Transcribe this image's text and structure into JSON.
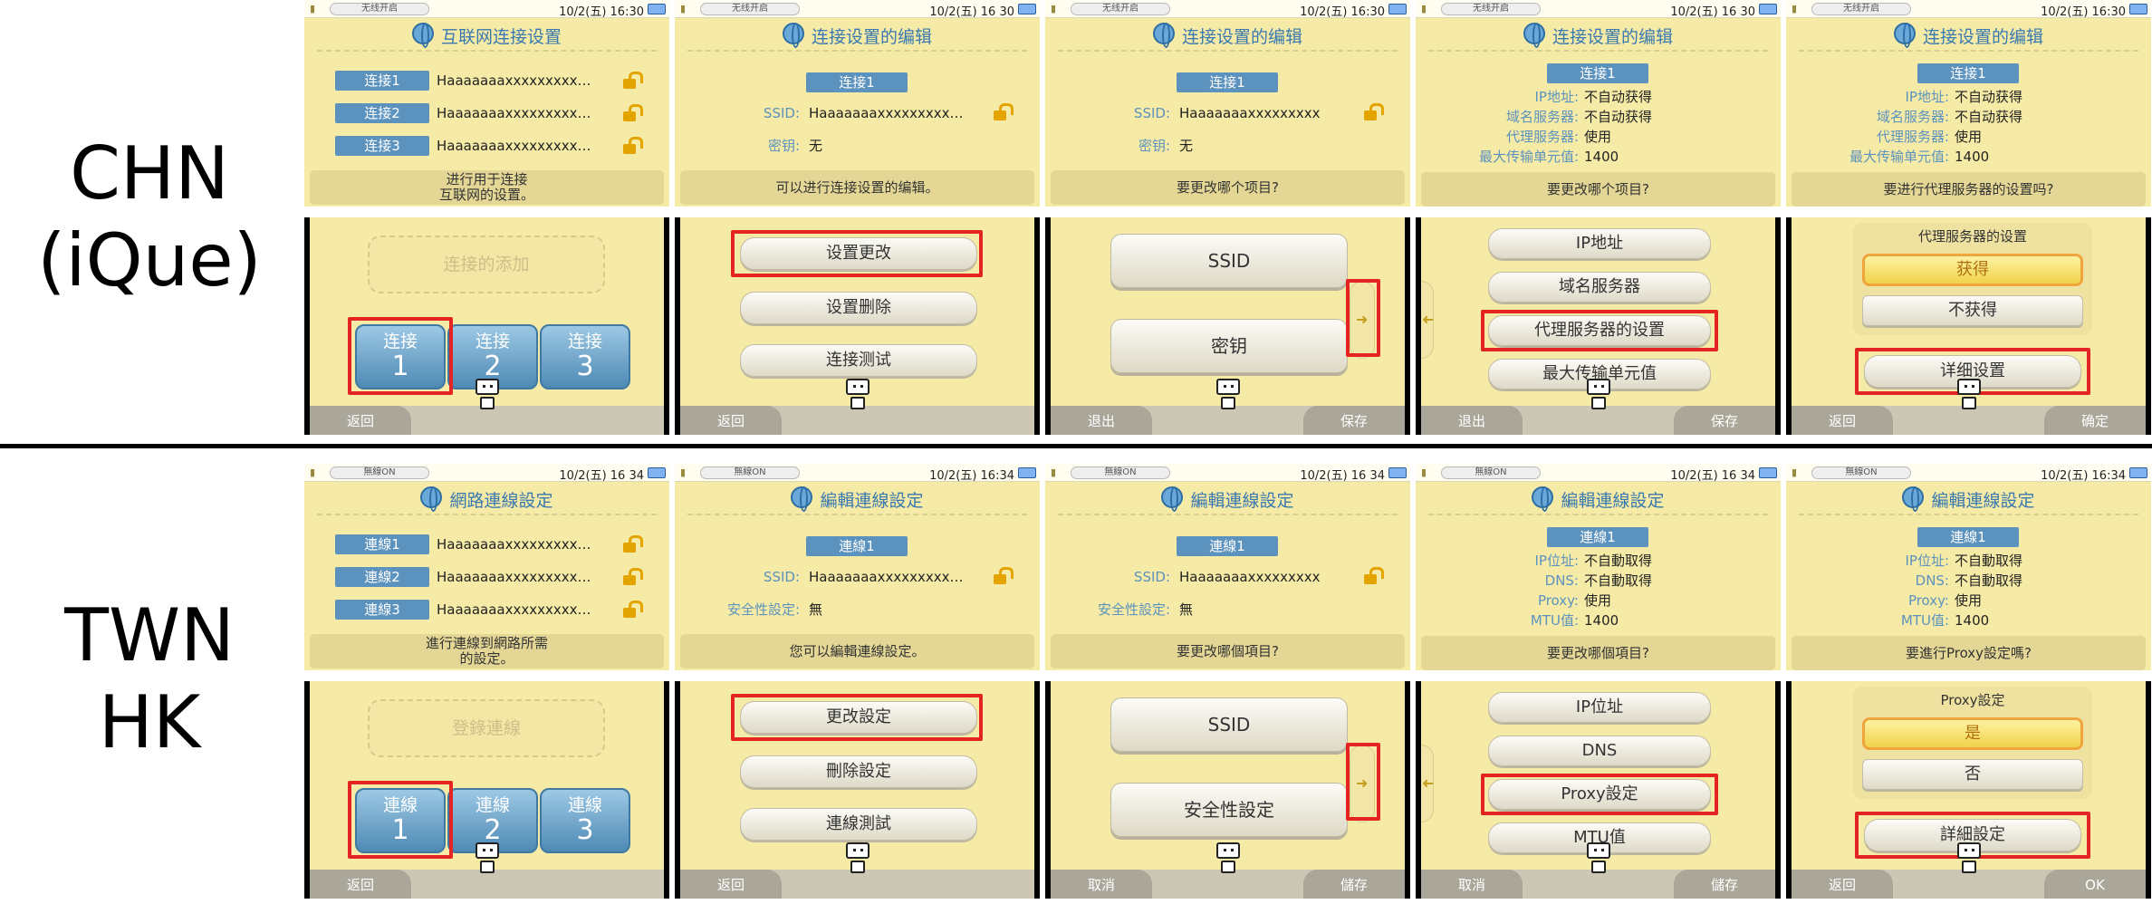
{
  "regions": [
    {
      "lines": [
        "CHN",
        "(iQue)"
      ]
    },
    {
      "lines": [
        "TWN",
        "HK"
      ]
    }
  ],
  "rows": [
    {
      "screens": [
        {
          "wlan": "无线开启",
          "time": "10/2(五) 16:30",
          "title": "互联网连接设置",
          "connections": [
            {
              "tag": "连接1",
              "ssid": "Haaaaaaaxxxxxxxxx…"
            },
            {
              "tag": "连接2",
              "ssid": "Haaaaaaaxxxxxxxxx…"
            },
            {
              "tag": "连接3",
              "ssid": "Haaaaaaaxxxxxxxxx…"
            }
          ],
          "message": "进行用于连接\n互联网的设置。",
          "add_label": "连接的添加",
          "conn_btn_top": "连接",
          "conn_nums": [
            "1",
            "2",
            "3"
          ],
          "left": "返回",
          "right": ""
        },
        {
          "wlan": "无线开启",
          "time": "10/2(五) 16 30",
          "title": "连接设置的编辑",
          "tag": "连接1",
          "fields": [
            {
              "label": "SSID:",
              "value": "Haaaaaaaxxxxxxxxx…"
            },
            {
              "label": "密钥:",
              "value": "无"
            }
          ],
          "message": "可以进行连接设置的编辑。",
          "menu": [
            "设置更改",
            "设置删除",
            "连接测试"
          ],
          "left": "返回",
          "right": ""
        },
        {
          "wlan": "无线开启",
          "time": "10/2(五) 16:30",
          "title": "连接设置的编辑",
          "tag": "连接1",
          "fields": [
            {
              "label": "SSID:",
              "value": "Haaaaaaaxxxxxxxxx"
            },
            {
              "label": "密钥:",
              "value": "无"
            }
          ],
          "message": "要更改哪个项目?",
          "big": [
            "SSID",
            "密钥"
          ],
          "arrow": "➜",
          "left": "退出",
          "right": "保存"
        },
        {
          "wlan": "无线开启",
          "time": "10/2(五) 16 30",
          "title": "连接设置的编辑",
          "tag": "连接1",
          "info": [
            {
              "label": "IP地址:",
              "value": "不自动获得"
            },
            {
              "label": "域名服务器:",
              "value": "不自动获得"
            },
            {
              "label": "代理服务器:",
              "value": "使用"
            },
            {
              "label": "最大传输单元值:",
              "value": "1400"
            }
          ],
          "message": "要更改哪个项目?",
          "menu": [
            "IP地址",
            "域名服务器",
            "代理服务器的设置",
            "最大传输单元值"
          ],
          "arrow": "➜",
          "left": "退出",
          "right": "保存"
        },
        {
          "wlan": "无线开启",
          "time": "10/2(五) 16:30",
          "title": "连接设置的编辑",
          "tag": "连接1",
          "info": [
            {
              "label": "IP地址:",
              "value": "不自动获得"
            },
            {
              "label": "域名服务器:",
              "value": "不自动获得"
            },
            {
              "label": "代理服务器:",
              "value": "使用"
            },
            {
              "label": "最大传输单元值:",
              "value": "1400"
            }
          ],
          "message": "要进行代理服务器的设置吗?",
          "panel_title": "代理服务器的设置",
          "opt_yes": "获得",
          "opt_no": "不获得",
          "detail": "详细设置",
          "left": "返回",
          "right": "确定"
        }
      ]
    },
    {
      "screens": [
        {
          "wlan": "無線ON",
          "time": "10/2(五) 16 34",
          "title": "網路連線設定",
          "connections": [
            {
              "tag": "連線1",
              "ssid": "Haaaaaaaxxxxxxxxx…"
            },
            {
              "tag": "連線2",
              "ssid": "Haaaaaaaxxxxxxxxx…"
            },
            {
              "tag": "連線3",
              "ssid": "Haaaaaaaxxxxxxxxx…"
            }
          ],
          "message": "進行連線到網路所需\n的設定。",
          "add_label": "登錄連線",
          "conn_btn_top": "連線",
          "conn_nums": [
            "1",
            "2",
            "3"
          ],
          "left": "返回",
          "right": ""
        },
        {
          "wlan": "無線ON",
          "time": "10/2(五) 16:34",
          "title": "編輯連線設定",
          "tag": "連線1",
          "fields": [
            {
              "label": "SSID:",
              "value": "Haaaaaaaxxxxxxxxx…"
            },
            {
              "label": "安全性設定:",
              "value": "無"
            }
          ],
          "message": "您可以編輯連線設定。",
          "menu": [
            "更改設定",
            "刪除設定",
            "連線測試"
          ],
          "left": "返回",
          "right": ""
        },
        {
          "wlan": "無線ON",
          "time": "10/2(五) 16 34",
          "title": "編輯連線設定",
          "tag": "連線1",
          "fields": [
            {
              "label": "SSID:",
              "value": "Haaaaaaaxxxxxxxxx"
            },
            {
              "label": "安全性設定:",
              "value": "無"
            }
          ],
          "message": "要更改哪個項目?",
          "big": [
            "SSID",
            "安全性設定"
          ],
          "arrow": "➜",
          "left": "取消",
          "right": "儲存"
        },
        {
          "wlan": "無線ON",
          "time": "10/2(五) 16 34",
          "title": "編輯連線設定",
          "tag": "連線1",
          "info": [
            {
              "label": "IP位址:",
              "value": "不自動取得"
            },
            {
              "label": "DNS:",
              "value": "不自動取得"
            },
            {
              "label": "Proxy:",
              "value": "使用"
            },
            {
              "label": "MTU值:",
              "value": "1400"
            }
          ],
          "message": "要更改哪個項目?",
          "menu": [
            "IP位址",
            "DNS",
            "Proxy設定",
            "MTU值"
          ],
          "arrow": "➜",
          "left": "取消",
          "right": "儲存"
        },
        {
          "wlan": "無線ON",
          "time": "10/2(五) 16:34",
          "title": "編輯連線設定",
          "tag": "連線1",
          "info": [
            {
              "label": "IP位址:",
              "value": "不自動取得"
            },
            {
              "label": "DNS:",
              "value": "不自動取得"
            },
            {
              "label": "Proxy:",
              "value": "使用"
            },
            {
              "label": "MTU值:",
              "value": "1400"
            }
          ],
          "message": "要進行Proxy設定嗎?",
          "panel_title": "Proxy設定",
          "opt_yes": "是",
          "opt_no": "否",
          "detail": "詳細設定",
          "left": "返回",
          "right": "OK"
        }
      ]
    }
  ]
}
